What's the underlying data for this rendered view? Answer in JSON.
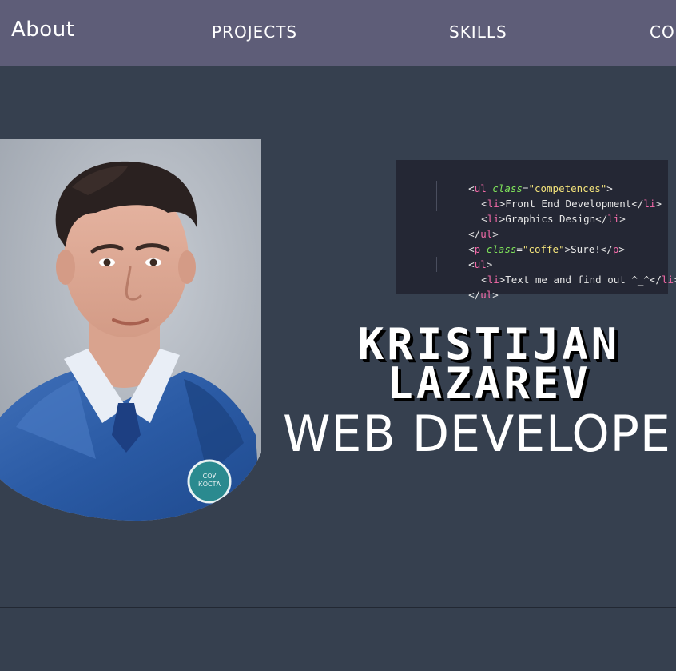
{
  "nav": {
    "about": "About",
    "projects": "PROJECTS",
    "skills": "SKILLS",
    "contact": "CO"
  },
  "hero": {
    "first_name": "KRISTIJAN",
    "last_name": "LAZAREV",
    "role": "WEB DEVELOPE"
  },
  "code": {
    "lines": [
      {
        "open": "<",
        "tag": "ul",
        "attr": "class",
        "eq": "=",
        "str": "\"competences\"",
        "close": ">"
      },
      {
        "open": "<",
        "tag": "li",
        "close": ">",
        "text": "Front End Development",
        "end_open": "</",
        "end_tag": "li",
        "end_close": ">"
      },
      {
        "open": "<",
        "tag": "li",
        "close": ">",
        "text": "Graphics Design",
        "end_open": "</",
        "end_tag": "li",
        "end_close": ">"
      },
      {
        "open": "</",
        "tag": "ul",
        "close": ">"
      },
      {
        "open": "<",
        "tag": "p",
        "attr": "class",
        "eq": "=",
        "str": "\"coffe\"",
        "close": ">",
        "text": "Sure!",
        "end_open": "</",
        "end_tag": "p",
        "end_close": ">"
      },
      {
        "open": "<",
        "tag": "ul",
        "close": ">"
      },
      {
        "open": "<",
        "tag": "li",
        "close": ">",
        "text": "Text me and find out ^_^",
        "end_open": "</",
        "end_tag": "li",
        "end_close": ">"
      },
      {
        "open": "</",
        "tag": "ul",
        "close": ">"
      }
    ]
  },
  "colors": {
    "nav_bg": "#5e5d78",
    "page_bg": "#36404f",
    "code_bg": "#242734",
    "code_tag": "#f36aa8",
    "code_attr": "#7fe35a",
    "code_string": "#f2e27a"
  }
}
